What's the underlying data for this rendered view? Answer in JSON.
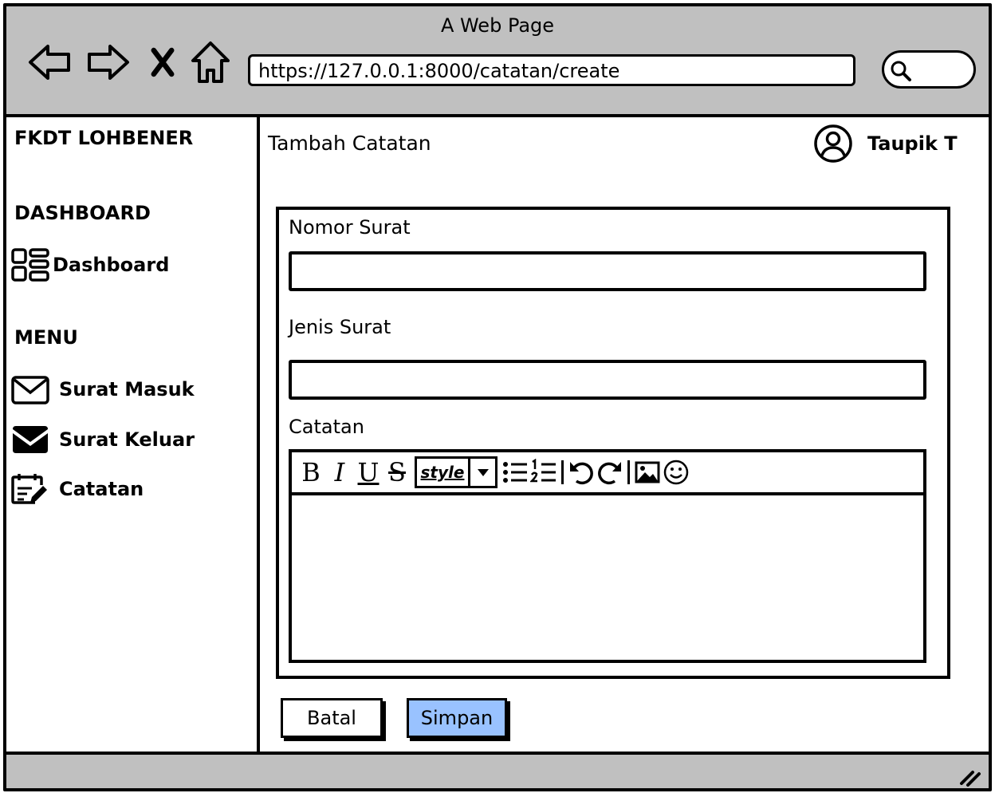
{
  "browser": {
    "title": "A Web Page",
    "url": "https://127.0.0.1:8000/catatan/create",
    "back_icon": "back-arrow-icon",
    "forward_icon": "forward-arrow-icon",
    "close_icon": "close-x-icon",
    "home_icon": "home-icon",
    "search_icon": "search-icon"
  },
  "sidebar": {
    "brand": "FKDT LOHBENER",
    "section_dashboard": "DASHBOARD",
    "dashboard_item": {
      "label": "Dashboard",
      "icon": "dashboard-icon"
    },
    "section_menu": "MENU",
    "menu_items": [
      {
        "label": "Surat Masuk",
        "icon": "envelope-outline-icon"
      },
      {
        "label": "Surat Keluar",
        "icon": "envelope-filled-icon"
      },
      {
        "label": "Catatan",
        "icon": "calendar-edit-icon"
      }
    ]
  },
  "header": {
    "page_title": "Tambah Catatan",
    "user_name": "Taupik T",
    "user_icon": "user-circle-icon"
  },
  "form": {
    "fields": [
      {
        "label": "Nomor Surat",
        "value": "",
        "placeholder": ""
      },
      {
        "label": "Jenis Surat",
        "value": "",
        "placeholder": ""
      }
    ],
    "notes_label": "Catatan",
    "editor": {
      "bold": "B",
      "italic": "I",
      "underline": "U",
      "strike": "S",
      "style_value": "style",
      "content": ""
    },
    "cancel_label": "Batal",
    "save_label": "Simpan"
  },
  "colors": {
    "chrome": "#c0c0c0",
    "save_button": "#99c2ff"
  }
}
